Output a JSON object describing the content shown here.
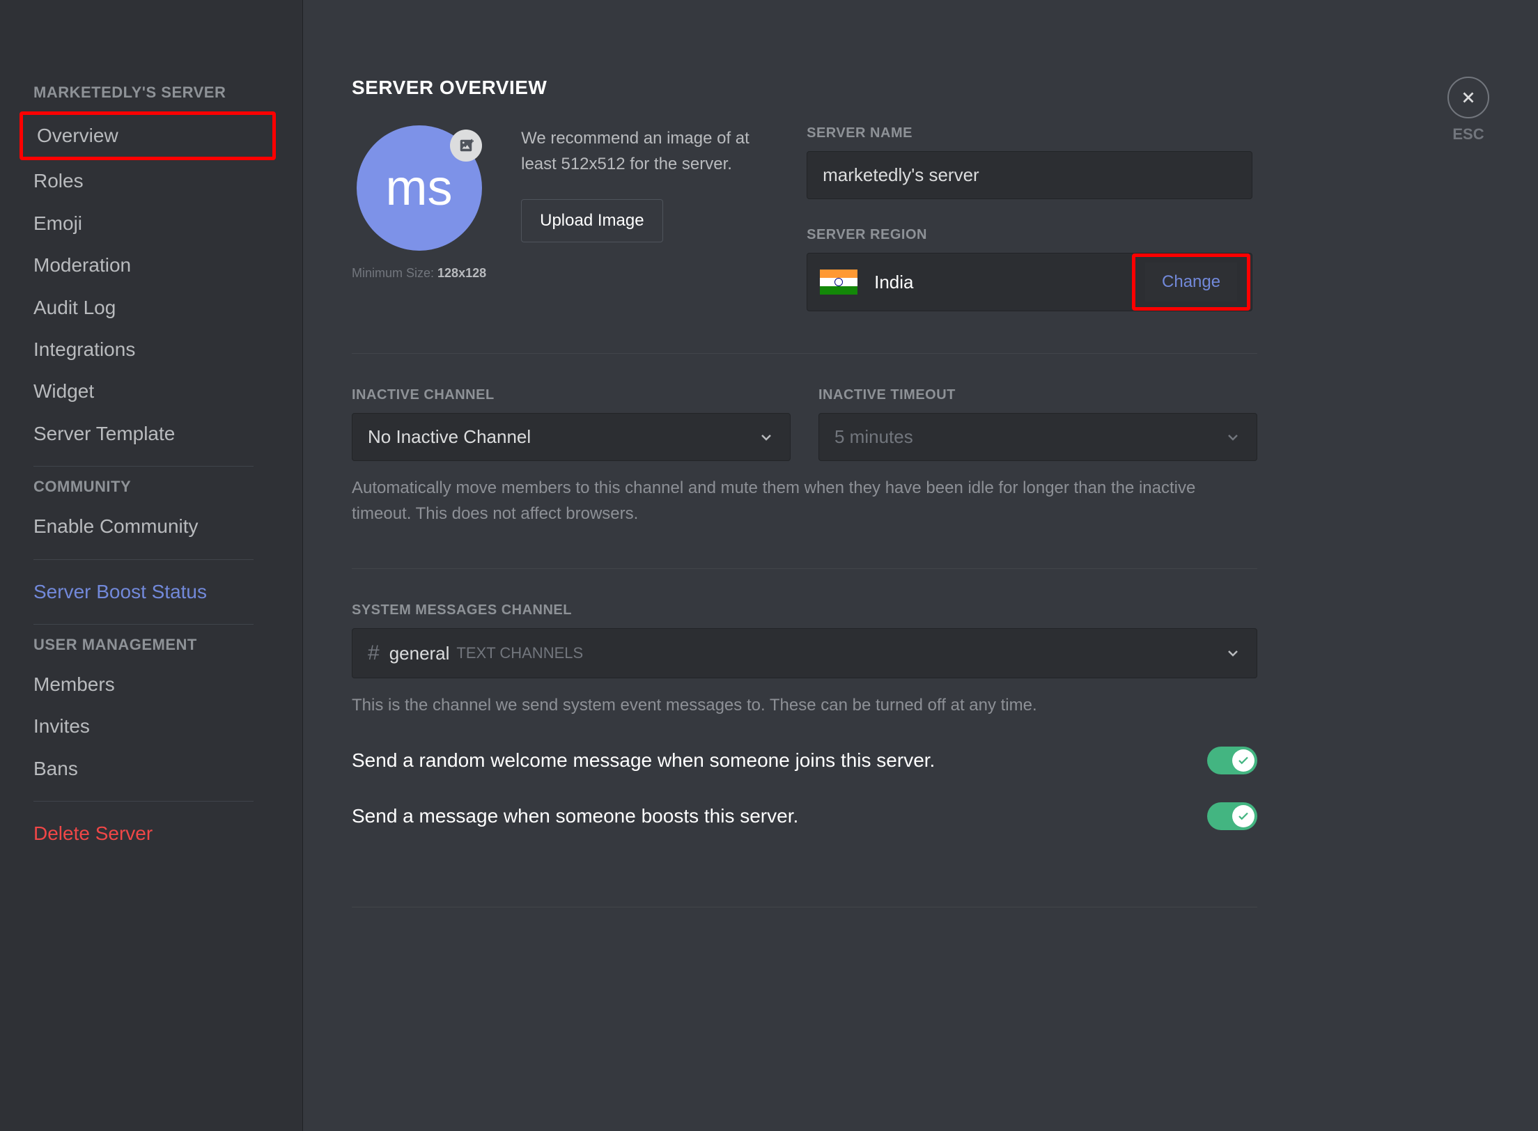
{
  "sidebar": {
    "server_category": "MARKETEDLY'S SERVER",
    "items_server": [
      {
        "label": "Overview",
        "selected": true
      },
      {
        "label": "Roles"
      },
      {
        "label": "Emoji"
      },
      {
        "label": "Moderation"
      },
      {
        "label": "Audit Log"
      },
      {
        "label": "Integrations"
      },
      {
        "label": "Widget"
      },
      {
        "label": "Server Template"
      }
    ],
    "community_category": "COMMUNITY",
    "enable_community": "Enable Community",
    "boost": "Server Boost Status",
    "user_mgmt_category": "USER MANAGEMENT",
    "items_user": [
      "Members",
      "Invites",
      "Bans"
    ],
    "delete": "Delete Server"
  },
  "close": {
    "esc": "ESC"
  },
  "page": {
    "title": "SERVER OVERVIEW",
    "icon_initials": "ms",
    "min_size_prefix": "Minimum Size: ",
    "min_size_value": "128x128",
    "recommend": "We recommend an image of at least 512x512 for the server.",
    "upload_btn": "Upload Image",
    "server_name_label": "SERVER NAME",
    "server_name_value": "marketedly's server",
    "server_region_label": "SERVER REGION",
    "region_name": "India",
    "change_btn": "Change"
  },
  "inactive": {
    "channel_label": "INACTIVE CHANNEL",
    "channel_value": "No Inactive Channel",
    "timeout_label": "INACTIVE TIMEOUT",
    "timeout_value": "5 minutes",
    "description": "Automatically move members to this channel and mute them when they have been idle for longer than the inactive timeout. This does not affect browsers."
  },
  "system": {
    "label": "SYSTEM MESSAGES CHANNEL",
    "channel": "general",
    "category": "TEXT CHANNELS",
    "description": "This is the channel we send system event messages to. These can be turned off at any time.",
    "toggle1": "Send a random welcome message when someone joins this server.",
    "toggle2": "Send a message when someone boosts this server."
  }
}
